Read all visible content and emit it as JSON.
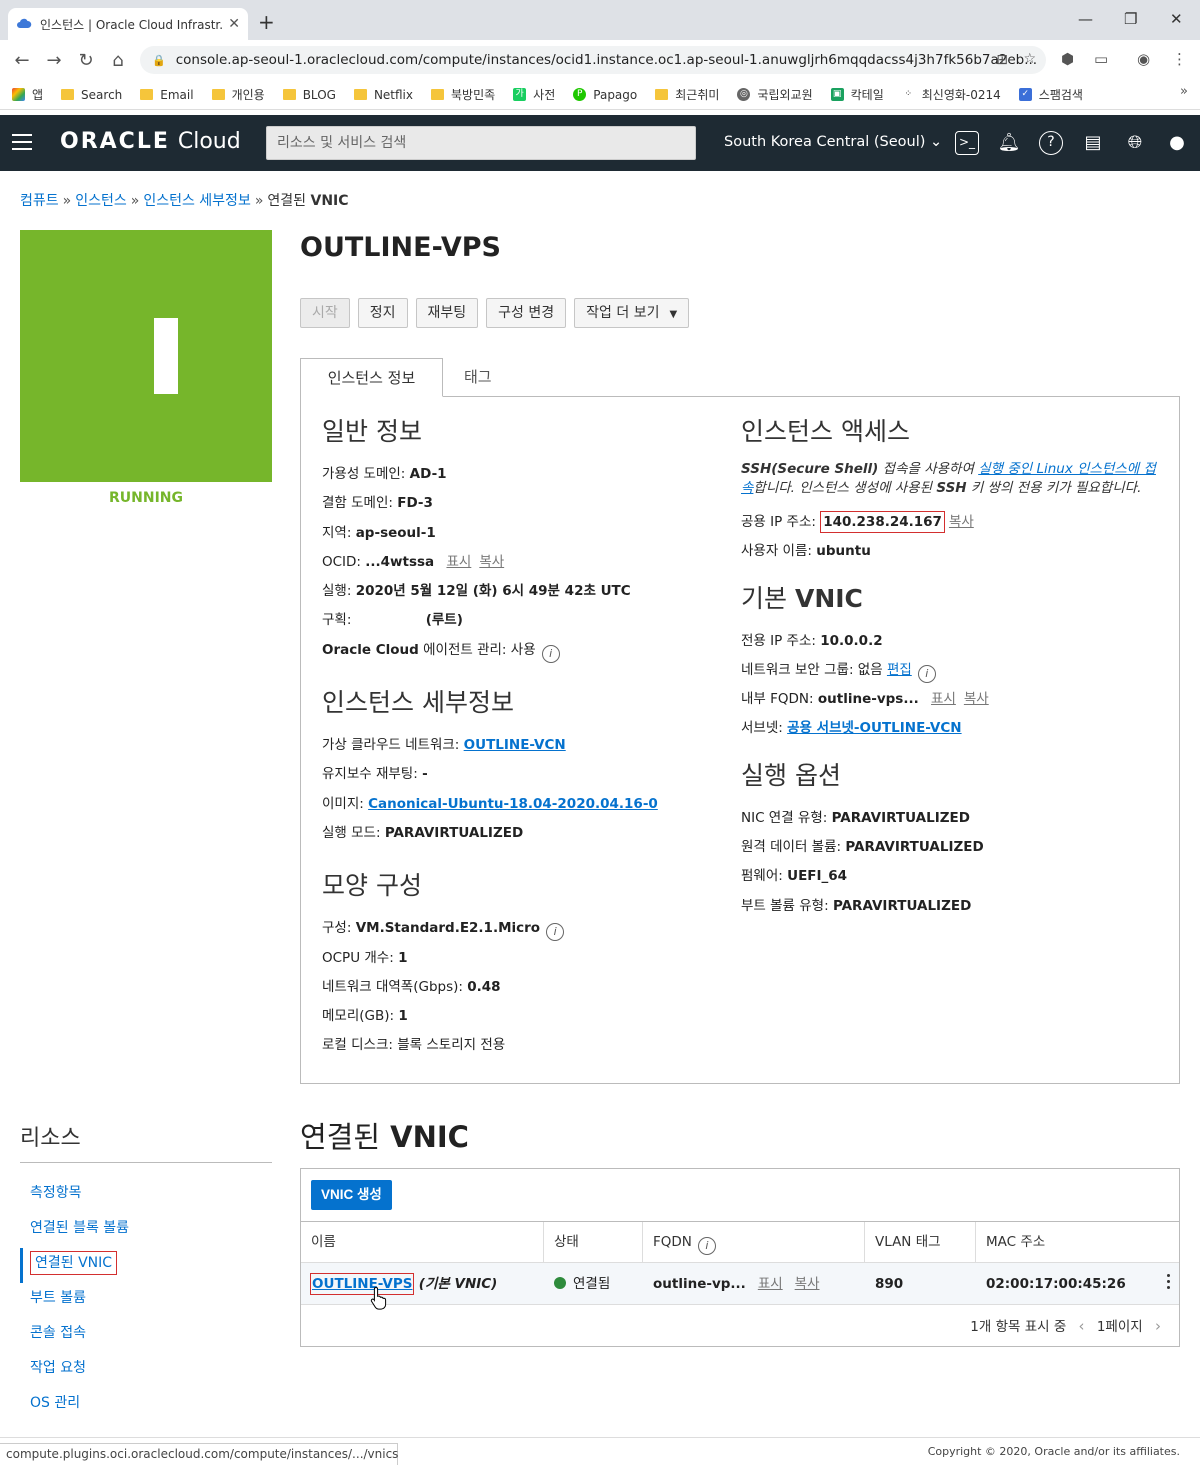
{
  "browser": {
    "tab_title": "인스턴스 | Oracle Cloud Infrastr...",
    "url": "console.ap-seoul-1.oraclecloud.com/compute/instances/ocid1.instance.oc1.ap-seoul-1.anuwgljrh6mqqdacss4j3h7fk56b7a2eb...",
    "bookmarks": [
      "앱",
      "Search",
      "Email",
      "개인용",
      "BLOG",
      "Netflix",
      "북방민족",
      "사전",
      "Papago",
      "최근취미",
      "국립외교원",
      "칵테일",
      "최신영화-0214",
      "스팸검색"
    ],
    "status_url": "compute.plugins.oci.oraclecloud.com/compute/instances/.../vnics"
  },
  "header": {
    "logo_oracle": "ORACLE",
    "logo_cloud": "Cloud",
    "search_placeholder": "리소스 및 서비스 검색",
    "region": "South Korea Central (Seoul)"
  },
  "breadcrumb": {
    "items": [
      "컴퓨트",
      "인스턴스",
      "인스턴스 세부정보"
    ],
    "current_prefix": "연결된",
    "current_bold": "VNIC"
  },
  "instance": {
    "badge_letter": "I",
    "badge_color": "#76b62b",
    "state": "RUNNING",
    "name": "OUTLINE-VPS"
  },
  "actions": [
    "시작",
    "정지",
    "재부팅",
    "구성 변경",
    "작업 더 보기"
  ],
  "tabs": [
    "인스턴스 정보",
    "태그"
  ],
  "general": {
    "title": "일반 정보",
    "ad_k": "가용성 도메인:",
    "ad_v": "AD-1",
    "fd_k": "결함 도메인:",
    "fd_v": "FD-3",
    "region_k": "지역:",
    "region_v": "ap-seoul-1",
    "ocid_k": "OCID:",
    "ocid_v": "...4wtssa",
    "show": "표시",
    "copy": "복사",
    "launched_k": "실행:",
    "launched_v": "2020년 5월 12일 (화) 6시 49분 42초 UTC",
    "compartment_k": "구획:",
    "compartment_v": "(루트)",
    "agent_k": "Oracle Cloud 에이전트 관리:",
    "agent_v": "사용"
  },
  "details": {
    "title": "인스턴스 세부정보",
    "vcn_k": "가상 클라우드 네트워크:",
    "vcn_v": "OUTLINE-VCN",
    "maint_k": "유지보수 재부팅:",
    "maint_v": "-",
    "image_k": "이미지:",
    "image_v": "Canonical-Ubuntu-18.04-2020.04.16-0",
    "mode_k": "실행 모드:",
    "mode_v": "PARAVIRTUALIZED"
  },
  "shape": {
    "title": "모양 구성",
    "shape_k": "구성:",
    "shape_v": "VM.Standard.E2.1.Micro",
    "ocpu_k": "OCPU 개수:",
    "ocpu_v": "1",
    "bw_k": "네트워크 대역폭(Gbps):",
    "bw_v": "0.48",
    "mem_k": "메모리(GB):",
    "mem_v": "1",
    "disk_k": "로컬 디스크:",
    "disk_v": "블록 스토리지 전용"
  },
  "access": {
    "title": "인스턴스 액세스",
    "ssh_bold": "SSH(Secure Shell)",
    "ssh_t1": " 접속을 사용하여 ",
    "ssh_link": "실행 중인 Linux 인스턴스에 접속",
    "ssh_t2": "합니다. 인스턴스 생성에 사용된 ",
    "ssh_bold2": "SSH",
    "ssh_t3": " 키 쌍의 전용 키가 필요합니다.",
    "pubip_k": "공용 IP 주소:",
    "pubip_v": "140.238.24.167",
    "copy": "복사",
    "user_k": "사용자 이름:",
    "user_v": "ubuntu"
  },
  "primary_vnic": {
    "title_pre": "기본",
    "title_bold": "VNIC",
    "privip_k": "전용 IP 주소:",
    "privip_v": "10.0.0.2",
    "nsg_k": "네트워크 보안 그룹:",
    "nsg_v": "없음",
    "edit": "편집",
    "fqdn_k": "내부 FQDN:",
    "fqdn_v": "outline-vps...",
    "show": "표시",
    "copy": "복사",
    "subnet_k": "서브넷:",
    "subnet_v": "공용 서브넷-OUTLINE-VCN"
  },
  "launch_options": {
    "title": "실행 옵션",
    "nic_k": "NIC 연결 유형:",
    "nic_v": "PARAVIRTUALIZED",
    "rdv_k": "원격 데이터 볼륨:",
    "rdv_v": "PARAVIRTUALIZED",
    "fw_k": "펌웨어:",
    "fw_v": "UEFI_64",
    "bv_k": "부트 볼륨 유형:",
    "bv_v": "PARAVIRTUALIZED"
  },
  "resources": {
    "title": "리소스",
    "items": [
      "측정항목",
      "연결된 블록 볼륨",
      "연결된 VNIC",
      "부트 볼륨",
      "콘솔 접속",
      "작업 요청",
      "OS 관리"
    ]
  },
  "vnics": {
    "title_pre": "연결된",
    "title_bold": "VNIC",
    "create_button": "VNIC 생성",
    "columns": [
      "이름",
      "상태",
      "FQDN",
      "VLAN 태그",
      "MAC 주소"
    ],
    "rows": [
      {
        "name": "OUTLINE-VPS",
        "note": "(기본 VNIC)",
        "state": "연결됨",
        "fqdn": "outline-vp...",
        "show": "표시",
        "copy": "복사",
        "vlan": "890",
        "mac": "02:00:17:00:45:26"
      }
    ],
    "count_text": "1개 항목 표시 중",
    "page": "1페이지"
  },
  "footer": {
    "copyright": "Copyright © 2020, Oracle and/or its affiliates."
  }
}
